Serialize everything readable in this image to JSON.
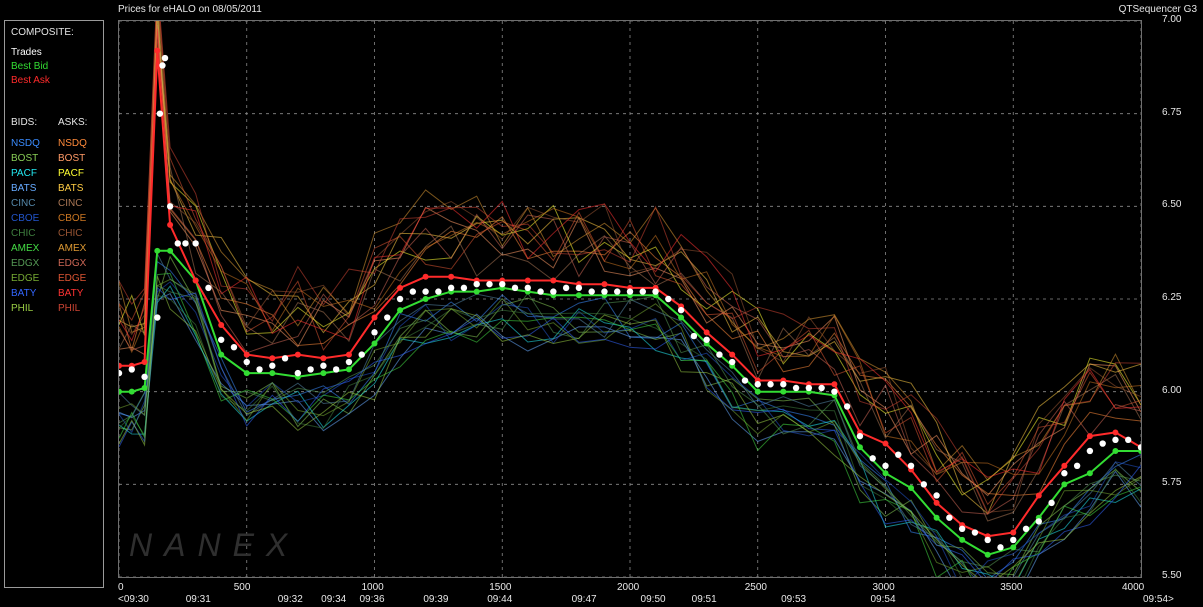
{
  "header": {
    "title": "Prices for  eHALO  on  08/05/2011",
    "app_name": "QTSequencer G3"
  },
  "legend": {
    "composite_label": "COMPOSITE:",
    "composite_items": [
      {
        "label": "Trades",
        "color": "#ffffff"
      },
      {
        "label": "Best Bid",
        "color": "#33dd33"
      },
      {
        "label": "Best Ask",
        "color": "#ff2b2b"
      }
    ],
    "bids_header": "BIDS:",
    "asks_header": "ASKS:",
    "exchanges": [
      {
        "bid": "NSDQ",
        "ask": "NSDQ",
        "bid_color": "#3a8cff",
        "ask_color": "#ff8a3a"
      },
      {
        "bid": "BOST",
        "ask": "BOST",
        "bid_color": "#88cc55",
        "ask_color": "#ff9a66"
      },
      {
        "bid": "PACF",
        "ask": "PACF",
        "bid_color": "#22e8f0",
        "ask_color": "#ffff33"
      },
      {
        "bid": "BATS",
        "ask": "BATS",
        "bid_color": "#66aaff",
        "ask_color": "#ffcc44"
      },
      {
        "bid": "CINC",
        "ask": "CINC",
        "bid_color": "#5588aa",
        "ask_color": "#aa7755"
      },
      {
        "bid": "CBOE",
        "ask": "CBOE",
        "bid_color": "#2255cc",
        "ask_color": "#cc7722"
      },
      {
        "bid": "CHIC",
        "ask": "CHIC",
        "bid_color": "#3f7f3f",
        "ask_color": "#995533"
      },
      {
        "bid": "AMEX",
        "ask": "AMEX",
        "bid_color": "#44dd44",
        "ask_color": "#dd9933"
      },
      {
        "bid": "EDGX",
        "ask": "EDGX",
        "bid_color": "#559955",
        "ask_color": "#cc6655"
      },
      {
        "bid": "EDGE",
        "ask": "EDGE",
        "bid_color": "#77aa33",
        "ask_color": "#dd5533"
      },
      {
        "bid": "BATY",
        "ask": "BATY",
        "bid_color": "#3366ff",
        "ask_color": "#ff3333"
      },
      {
        "bid": "PHIL",
        "ask": "PHIL",
        "bid_color": "#99cc44",
        "ask_color": "#cc4433"
      }
    ]
  },
  "watermark": "NANEX",
  "chart_data": {
    "type": "line",
    "ylim": [
      5.5,
      7.0
    ],
    "xlim": [
      0,
      4000
    ],
    "y_ticks": [
      "7.00",
      "6.75",
      "6.50",
      "6.25",
      "6.00",
      "5.75",
      "5.50"
    ],
    "y_tick_values": [
      7.0,
      6.75,
      6.5,
      6.25,
      6.0,
      5.75,
      5.5
    ],
    "x_ticks": [
      0,
      500,
      1000,
      1500,
      2000,
      2500,
      3000,
      3500,
      4000
    ],
    "x_tick_labels": [
      "0",
      "500",
      "1000",
      "1500",
      "2000",
      "2500",
      "3000",
      "3500",
      "4000"
    ],
    "time_labels": [
      {
        "x": 0,
        "label": "<09:30"
      },
      {
        "x": 320,
        "label": "09:31"
      },
      {
        "x": 680,
        "label": "09:32"
      },
      {
        "x": 850,
        "label": "09:34"
      },
      {
        "x": 1000,
        "label": "09:36"
      },
      {
        "x": 1250,
        "label": "09:39"
      },
      {
        "x": 1500,
        "label": "09:44"
      },
      {
        "x": 1830,
        "label": "09:47"
      },
      {
        "x": 2100,
        "label": "09:50"
      },
      {
        "x": 2300,
        "label": "09:51"
      },
      {
        "x": 2650,
        "label": "09:53"
      },
      {
        "x": 3000,
        "label": "09:54"
      },
      {
        "x": 4000,
        "label": "09:54>"
      }
    ],
    "grid": true,
    "series": [
      {
        "name": "Trades",
        "color": "#ffffff",
        "x": [
          0,
          50,
          100,
          150,
          160,
          170,
          180,
          200,
          230,
          260,
          300,
          350,
          400,
          450,
          500,
          550,
          600,
          650,
          700,
          750,
          800,
          850,
          900,
          950,
          1000,
          1050,
          1100,
          1150,
          1200,
          1250,
          1300,
          1350,
          1400,
          1450,
          1500,
          1550,
          1600,
          1650,
          1700,
          1750,
          1800,
          1850,
          1900,
          1950,
          2000,
          2050,
          2100,
          2150,
          2200,
          2250,
          2300,
          2350,
          2400,
          2450,
          2500,
          2550,
          2600,
          2650,
          2700,
          2750,
          2800,
          2850,
          2900,
          2950,
          3000,
          3050,
          3100,
          3150,
          3200,
          3250,
          3300,
          3350,
          3400,
          3450,
          3500,
          3550,
          3600,
          3650,
          3700,
          3750,
          3800,
          3850,
          3900,
          3950,
          4000
        ],
        "y": [
          6.05,
          6.06,
          6.04,
          6.2,
          6.75,
          6.88,
          6.9,
          6.5,
          6.4,
          6.4,
          6.4,
          6.28,
          6.14,
          6.12,
          6.08,
          6.06,
          6.07,
          6.09,
          6.05,
          6.06,
          6.07,
          6.06,
          6.08,
          6.1,
          6.16,
          6.2,
          6.25,
          6.27,
          6.27,
          6.27,
          6.28,
          6.28,
          6.29,
          6.29,
          6.29,
          6.28,
          6.28,
          6.27,
          6.27,
          6.28,
          6.28,
          6.27,
          6.27,
          6.27,
          6.27,
          6.27,
          6.27,
          6.25,
          6.22,
          6.15,
          6.14,
          6.1,
          6.08,
          6.03,
          6.02,
          6.02,
          6.02,
          6.01,
          6.01,
          6.01,
          6.0,
          5.96,
          5.88,
          5.82,
          5.8,
          5.83,
          5.8,
          5.75,
          5.72,
          5.66,
          5.63,
          5.62,
          5.6,
          5.58,
          5.6,
          5.63,
          5.65,
          5.7,
          5.78,
          5.8,
          5.84,
          5.86,
          5.87,
          5.87,
          5.85
        ]
      },
      {
        "name": "Best Bid",
        "color": "#33dd33",
        "x": [
          0,
          50,
          100,
          150,
          200,
          300,
          400,
          500,
          600,
          700,
          800,
          900,
          1000,
          1100,
          1200,
          1300,
          1400,
          1500,
          1600,
          1700,
          1800,
          1900,
          2000,
          2100,
          2200,
          2300,
          2400,
          2500,
          2600,
          2700,
          2800,
          2900,
          3000,
          3100,
          3200,
          3300,
          3400,
          3500,
          3600,
          3700,
          3800,
          3900,
          4000
        ],
        "y": [
          6.0,
          6.0,
          6.01,
          6.38,
          6.38,
          6.3,
          6.1,
          6.05,
          6.05,
          6.04,
          6.05,
          6.06,
          6.13,
          6.22,
          6.25,
          6.27,
          6.27,
          6.28,
          6.27,
          6.26,
          6.26,
          6.26,
          6.26,
          6.26,
          6.2,
          6.13,
          6.07,
          6.0,
          6.0,
          6.0,
          5.99,
          5.85,
          5.78,
          5.74,
          5.66,
          5.6,
          5.56,
          5.58,
          5.66,
          5.75,
          5.78,
          5.84,
          5.84
        ]
      },
      {
        "name": "Best Ask",
        "color": "#ff2b2b",
        "x": [
          0,
          50,
          100,
          150,
          200,
          300,
          400,
          500,
          600,
          700,
          800,
          900,
          1000,
          1100,
          1200,
          1300,
          1400,
          1500,
          1600,
          1700,
          1800,
          1900,
          2000,
          2100,
          2200,
          2300,
          2400,
          2500,
          2600,
          2700,
          2800,
          2900,
          3000,
          3100,
          3200,
          3300,
          3400,
          3500,
          3600,
          3700,
          3800,
          3900,
          4000
        ],
        "y": [
          6.07,
          6.07,
          6.08,
          6.92,
          6.45,
          6.3,
          6.18,
          6.1,
          6.09,
          6.1,
          6.09,
          6.1,
          6.2,
          6.28,
          6.31,
          6.31,
          6.3,
          6.3,
          6.3,
          6.3,
          6.29,
          6.29,
          6.28,
          6.28,
          6.23,
          6.16,
          6.1,
          6.03,
          6.03,
          6.02,
          6.02,
          5.89,
          5.86,
          5.79,
          5.7,
          5.64,
          5.61,
          5.62,
          5.72,
          5.8,
          5.88,
          5.89,
          5.85
        ]
      }
    ]
  }
}
